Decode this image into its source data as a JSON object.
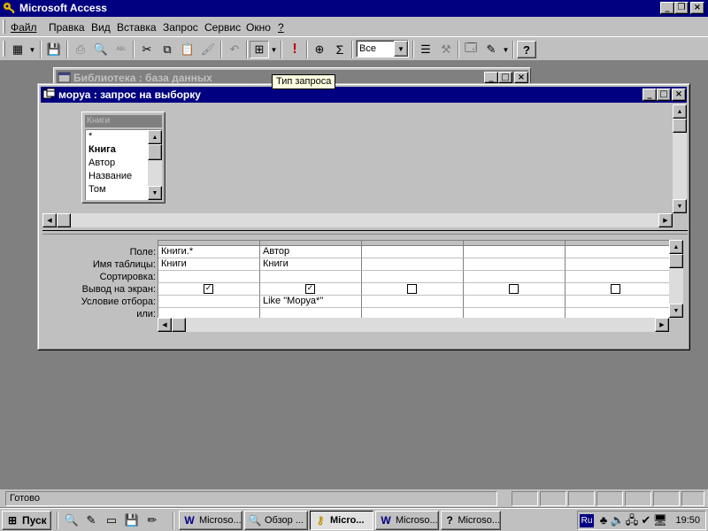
{
  "app": {
    "title": "Microsoft Access"
  },
  "menu": {
    "items": [
      {
        "label": "Файл"
      },
      {
        "label": "Правка"
      },
      {
        "label": "Вид"
      },
      {
        "label": "Вставка"
      },
      {
        "label": "Запрос"
      },
      {
        "label": "Сервис"
      },
      {
        "label": "Окно"
      },
      {
        "label": "?"
      }
    ]
  },
  "toolbar": {
    "top_values": "Все"
  },
  "tooltip": {
    "text": "Тип запроса"
  },
  "db_window": {
    "title": "Библиотека : база данных"
  },
  "query_window": {
    "title": "моруа : запрос на выборку"
  },
  "table_list": {
    "title": "Книги",
    "fields": [
      {
        "label": "*",
        "bold": false
      },
      {
        "label": "Книга",
        "bold": true
      },
      {
        "label": "Автор",
        "bold": false
      },
      {
        "label": "Название",
        "bold": false
      },
      {
        "label": "Том",
        "bold": false
      }
    ]
  },
  "grid": {
    "row_labels": [
      "Поле:",
      "Имя таблицы:",
      "Сортировка:",
      "Вывод на экран:",
      "Условие отбора:",
      "или:"
    ],
    "columns": [
      {
        "field": "Книги.*",
        "table": "Книги",
        "sort": "",
        "show": true,
        "criteria": "",
        "or": ""
      },
      {
        "field": "Автор",
        "table": "Книги",
        "sort": "",
        "show": true,
        "criteria": "Like \"Моруа*\"",
        "or": ""
      },
      {
        "field": "",
        "table": "",
        "sort": "",
        "show": false,
        "criteria": "",
        "or": ""
      },
      {
        "field": "",
        "table": "",
        "sort": "",
        "show": false,
        "criteria": "",
        "or": ""
      },
      {
        "field": "",
        "table": "",
        "sort": "",
        "show": false,
        "criteria": "",
        "or": ""
      }
    ]
  },
  "status": {
    "text": "Готово"
  },
  "taskbar": {
    "start_label": "Пуск",
    "tasks": [
      {
        "label": "Microso...",
        "icon": "word-icon",
        "active": false
      },
      {
        "label": "Обзор ...",
        "icon": "explorer-icon",
        "active": false
      },
      {
        "label": "Micro...",
        "icon": "access-key-icon",
        "active": true
      },
      {
        "label": "Microso...",
        "icon": "word-icon",
        "active": false
      },
      {
        "label": "Microso...",
        "icon": "help-icon",
        "active": false
      }
    ],
    "language": "Ru",
    "clock": "19:50"
  }
}
